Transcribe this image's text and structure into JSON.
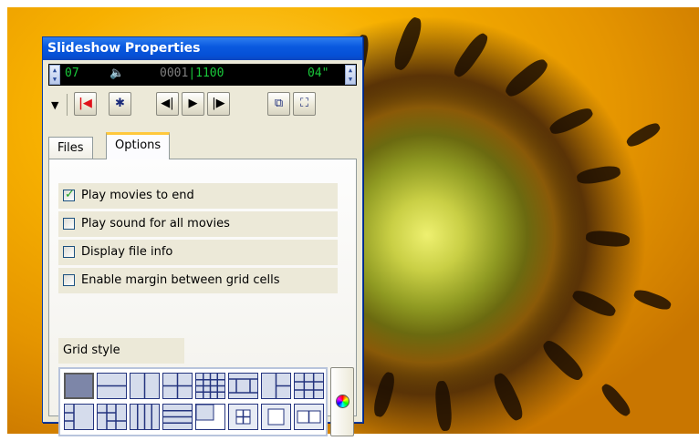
{
  "window": {
    "title": "Slideshow Properties"
  },
  "status": {
    "left_value": "07",
    "counter_a": "0001",
    "counter_sep": "|",
    "counter_b": "1100",
    "right_value": "04\""
  },
  "toolbar": {
    "buttons": [
      {
        "icon": "dropdown-arrow-icon"
      },
      {
        "icon": "go-to-start-icon",
        "glyph": "|◀"
      },
      {
        "icon": "settings-gear-icon",
        "glyph": "✱"
      },
      {
        "icon": "previous-icon",
        "glyph": "◀|"
      },
      {
        "icon": "play-icon",
        "glyph": "▶"
      },
      {
        "icon": "next-icon",
        "glyph": "|▶"
      },
      {
        "icon": "fit-to-window-icon",
        "glyph": "⧉"
      },
      {
        "icon": "fullscreen-icon",
        "glyph": "⛶"
      }
    ]
  },
  "tabs": [
    {
      "label": "Files"
    },
    {
      "label": "Options"
    }
  ],
  "options": [
    {
      "label": "Play movies to end",
      "checked": true
    },
    {
      "label": "Play sound for all movies",
      "checked": false
    },
    {
      "label": "Display file info",
      "checked": false
    },
    {
      "label": "Enable margin between grid cells",
      "checked": false
    }
  ],
  "grid_style": {
    "label": "Grid style",
    "icons": [
      "grid-1x1-icon",
      "grid-2-rows-icon",
      "grid-2-cols-icon",
      "grid-2x2-icon",
      "grid-4x4-icon",
      "grid-wide-center-icon",
      "grid-left-large-icon",
      "grid-3x3-icon",
      "grid-left-column-icon",
      "grid-staggered-icon",
      "grid-4-cols-icon",
      "grid-4-rows-icon",
      "grid-bottom-left-icon",
      "grid-center-small-icon",
      "grid-center-medium-icon",
      "grid-center-wide-icon"
    ]
  },
  "colors": {
    "title_bar": "#0a5ae0",
    "status_text": "#19c93a",
    "accent_red": "#e0101a"
  }
}
